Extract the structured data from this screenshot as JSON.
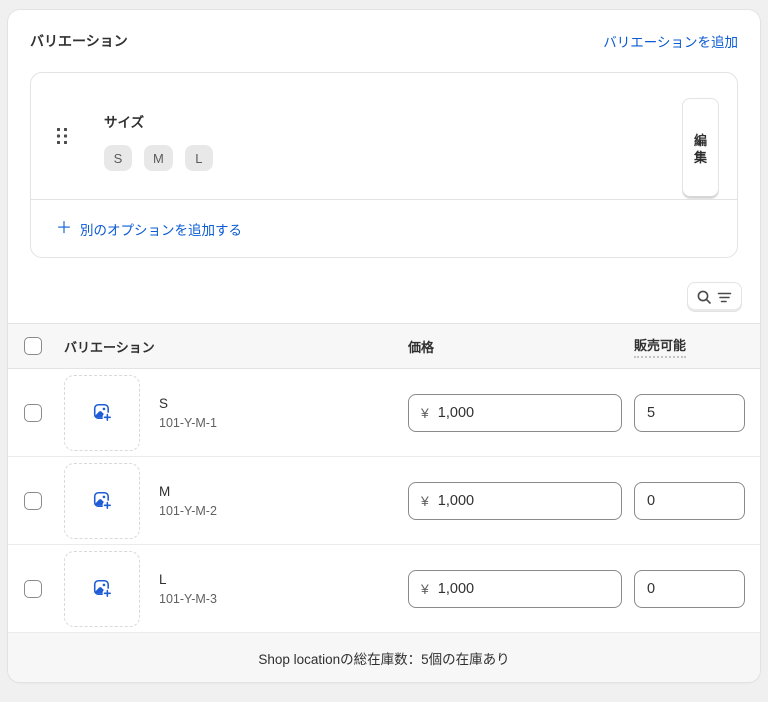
{
  "card": {
    "title": "バリエーション",
    "add_variant_link": "バリエーションを追加"
  },
  "option": {
    "name": "サイズ",
    "values": [
      "S",
      "M",
      "L"
    ],
    "edit_label": "編集",
    "add_another_plus": "＋",
    "add_another_label": "別のオプションを追加する"
  },
  "table": {
    "headers": {
      "variant": "バリエーション",
      "price": "価格",
      "available": "販売可能"
    },
    "rows": [
      {
        "name": "S",
        "sku": "101-Y-M-1",
        "price_prefix": "¥",
        "price": "1,000",
        "available": "5"
      },
      {
        "name": "M",
        "sku": "101-Y-M-2",
        "price_prefix": "¥",
        "price": "1,000",
        "available": "0"
      },
      {
        "name": "L",
        "sku": "101-Y-M-3",
        "price_prefix": "¥",
        "price": "1,000",
        "available": "0"
      }
    ],
    "footer": "Shop locationの総在庫数：5個の在庫あり"
  },
  "icons": {
    "drag_handle": "drag-handle-icon",
    "image_add": "image-add-icon",
    "search": "search-icon",
    "filter": "filter-icon"
  },
  "colors": {
    "link_blue": "#0a5bd3",
    "icon_blue": "#1f5dd6",
    "header_bg": "#f7f7f7",
    "border": "#e3e3e3",
    "input_border": "#8a8a8a",
    "chip_bg": "#e8e8e8",
    "text": "#303030",
    "subdued_text": "#616161"
  }
}
